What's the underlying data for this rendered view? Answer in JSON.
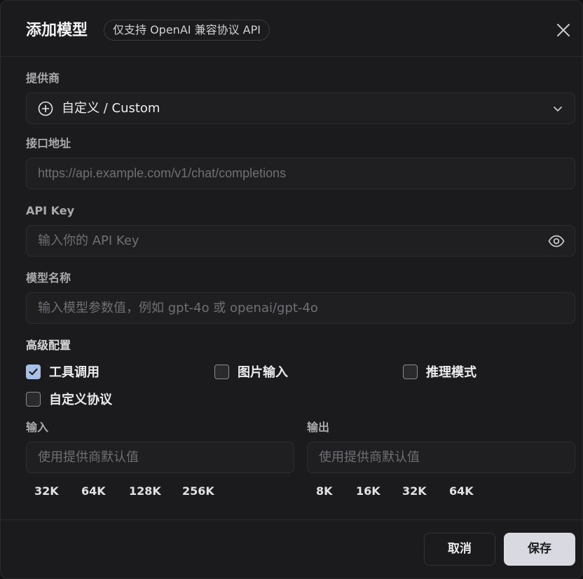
{
  "dialog": {
    "title": "添加模型",
    "badge": "仅支持 OpenAI 兼容协议 API"
  },
  "provider": {
    "label": "提供商",
    "selected": "自定义 / Custom"
  },
  "endpoint": {
    "label": "接口地址",
    "placeholder": "https://api.example.com/v1/chat/completions",
    "value": ""
  },
  "api_key": {
    "label": "API Key",
    "placeholder": "输入你的 API Key",
    "value": ""
  },
  "model_name": {
    "label": "模型名称",
    "placeholder": "输入模型参数值，例如 gpt-4o 或 openai/gpt-4o",
    "value": ""
  },
  "advanced": {
    "label": "高级配置",
    "options": [
      {
        "label": "工具调用",
        "checked": true
      },
      {
        "label": "图片输入",
        "checked": false
      },
      {
        "label": "推理模式",
        "checked": false
      },
      {
        "label": "自定义协议",
        "checked": false
      }
    ]
  },
  "input_tokens": {
    "label": "输入",
    "placeholder": "使用提供商默认值",
    "presets": [
      "32K",
      "64K",
      "128K",
      "256K"
    ]
  },
  "output_tokens": {
    "label": "输出",
    "placeholder": "使用提供商默认值",
    "presets": [
      "8K",
      "16K",
      "32K",
      "64K"
    ]
  },
  "footer": {
    "cancel": "取消",
    "save": "保存"
  },
  "colors": {
    "accent": "#a8c0e6",
    "primary_button": "#d9d9e2",
    "surface": "#1b1b1d"
  }
}
